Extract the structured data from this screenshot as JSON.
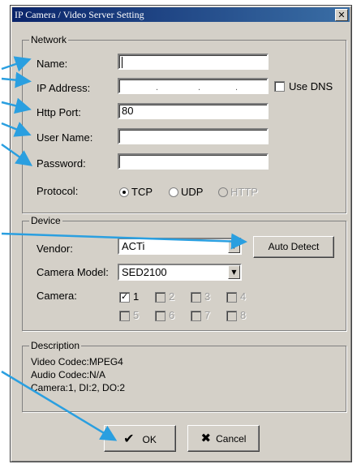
{
  "window": {
    "title": "IP Camera / Video Server Setting",
    "close_glyph": "✕"
  },
  "network": {
    "legend": "Network",
    "name_label": "Name:",
    "name_value": "",
    "ip_label": "IP Address:",
    "ip_dot": ".",
    "use_dns_label": "Use DNS",
    "http_port_label": "Http Port:",
    "http_port_value": "80",
    "user_name_label": "User Name:",
    "user_name_value": "",
    "password_label": "Password:",
    "password_value": "",
    "protocol_label": "Protocol:",
    "protocols": [
      "TCP",
      "UDP",
      "HTTP"
    ],
    "protocol_selected": "TCP"
  },
  "device": {
    "legend": "Device",
    "vendor_label": "Vendor:",
    "vendor_value": "ACTi",
    "auto_detect_label": "Auto Detect",
    "camera_model_label": "Camera Model:",
    "camera_model_value": "SED2100",
    "camera_label": "Camera:",
    "cameras": [
      "1",
      "2",
      "3",
      "4",
      "5",
      "6",
      "7",
      "8"
    ],
    "camera_checked": "1"
  },
  "description": {
    "legend": "Description",
    "lines": [
      "Video Codec:MPEG4",
      "Audio Codec:N/A",
      "Camera:1, DI:2, DO:2"
    ]
  },
  "buttons": {
    "ok_label": "OK",
    "ok_icon": "checkmark-icon",
    "cancel_label": "Cancel",
    "cancel_icon": "x-icon"
  },
  "colors": {
    "title_start": "#0a246a",
    "title_end": "#3a6ea5",
    "dialog_bg": "#d4d0c8",
    "annotation_arrow": "#2a9fe0"
  }
}
